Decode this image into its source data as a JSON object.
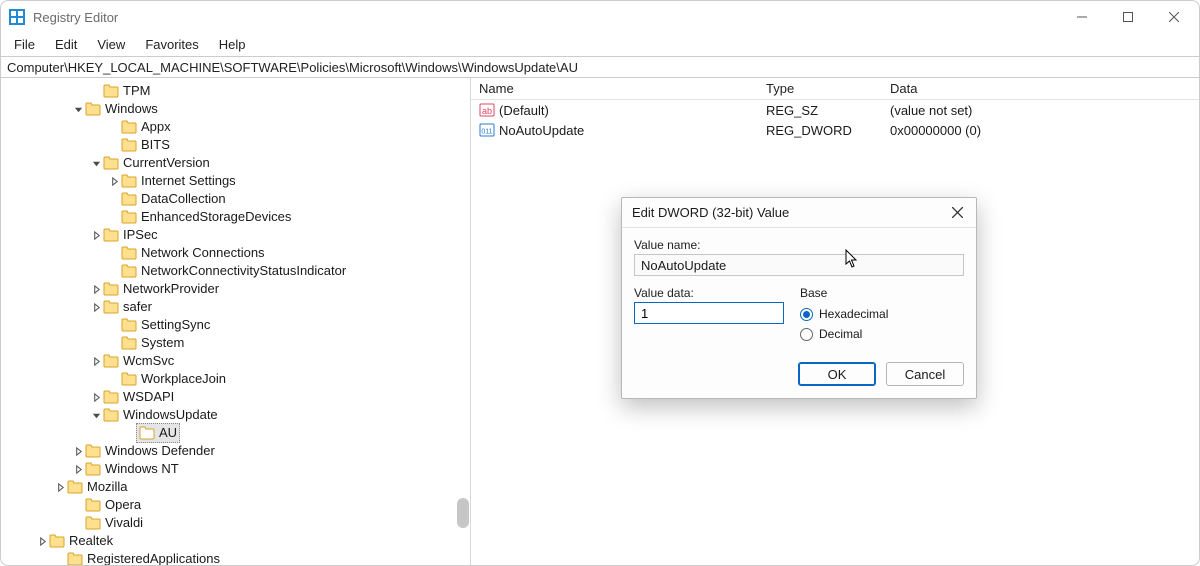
{
  "window": {
    "title": "Registry Editor",
    "minimize_tip": "Minimize",
    "maximize_tip": "Maximize",
    "close_tip": "Close"
  },
  "menu": {
    "items": [
      "File",
      "Edit",
      "View",
      "Favorites",
      "Help"
    ]
  },
  "address": {
    "path": "Computer\\HKEY_LOCAL_MACHINE\\SOFTWARE\\Policies\\Microsoft\\Windows\\WindowsUpdate\\AU"
  },
  "tree": [
    {
      "indent": 88,
      "expander": "",
      "label": "TPM"
    },
    {
      "indent": 70,
      "expander": "v",
      "label": "Windows"
    },
    {
      "indent": 106,
      "expander": "",
      "label": "Appx"
    },
    {
      "indent": 106,
      "expander": "",
      "label": "BITS"
    },
    {
      "indent": 88,
      "expander": "v",
      "label": "CurrentVersion"
    },
    {
      "indent": 106,
      "expander": ">",
      "label": "Internet Settings"
    },
    {
      "indent": 106,
      "expander": "",
      "label": "DataCollection"
    },
    {
      "indent": 106,
      "expander": "",
      "label": "EnhancedStorageDevices"
    },
    {
      "indent": 88,
      "expander": ">",
      "label": "IPSec"
    },
    {
      "indent": 106,
      "expander": "",
      "label": "Network Connections"
    },
    {
      "indent": 106,
      "expander": "",
      "label": "NetworkConnectivityStatusIndicator"
    },
    {
      "indent": 88,
      "expander": ">",
      "label": "NetworkProvider"
    },
    {
      "indent": 88,
      "expander": ">",
      "label": "safer"
    },
    {
      "indent": 106,
      "expander": "",
      "label": "SettingSync"
    },
    {
      "indent": 106,
      "expander": "",
      "label": "System"
    },
    {
      "indent": 88,
      "expander": ">",
      "label": "WcmSvc"
    },
    {
      "indent": 106,
      "expander": "",
      "label": "WorkplaceJoin"
    },
    {
      "indent": 88,
      "expander": ">",
      "label": "WSDAPI"
    },
    {
      "indent": 88,
      "expander": "v",
      "label": "WindowsUpdate"
    },
    {
      "indent": 124,
      "expander": "",
      "label": "AU",
      "selected": true
    },
    {
      "indent": 70,
      "expander": ">",
      "label": "Windows Defender"
    },
    {
      "indent": 70,
      "expander": ">",
      "label": "Windows NT"
    },
    {
      "indent": 52,
      "expander": ">",
      "label": "Mozilla"
    },
    {
      "indent": 70,
      "expander": "",
      "label": "Opera"
    },
    {
      "indent": 70,
      "expander": "",
      "label": "Vivaldi"
    },
    {
      "indent": 34,
      "expander": ">",
      "label": "Realtek"
    },
    {
      "indent": 52,
      "expander": "",
      "label": "RegisteredApplications"
    }
  ],
  "list": {
    "headers": {
      "name": "Name",
      "type": "Type",
      "data": "Data"
    },
    "rows": [
      {
        "icon": "string",
        "name": "(Default)",
        "type": "REG_SZ",
        "data": "(value not set)"
      },
      {
        "icon": "binary",
        "name": "NoAutoUpdate",
        "type": "REG_DWORD",
        "data": "0x00000000 (0)"
      }
    ]
  },
  "dialog": {
    "title": "Edit DWORD (32-bit) Value",
    "value_name_label": "Value name:",
    "value_name": "NoAutoUpdate",
    "value_data_label": "Value data:",
    "value_data": "1",
    "base_label": "Base",
    "radio_hex": "Hexadecimal",
    "radio_dec": "Decimal",
    "selected_base": "hex",
    "ok": "OK",
    "cancel": "Cancel"
  }
}
